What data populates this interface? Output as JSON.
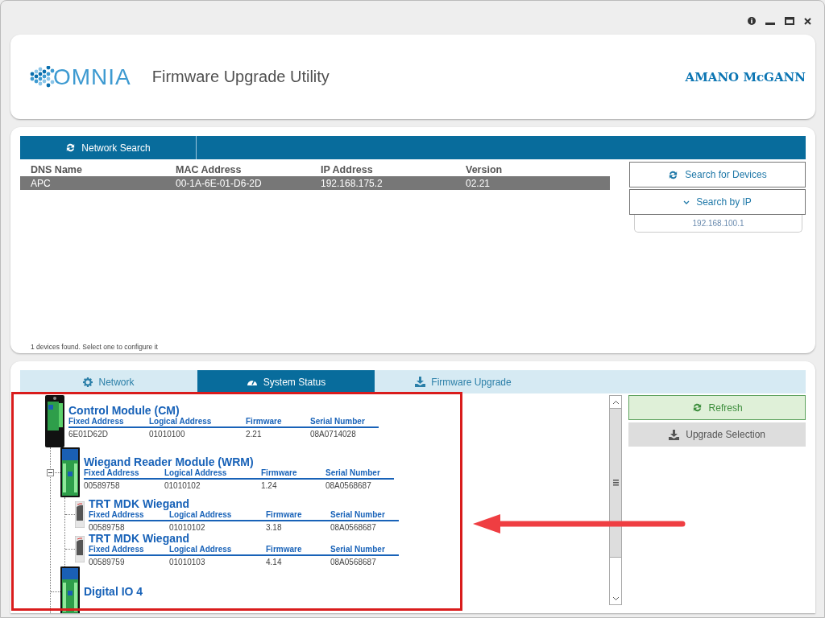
{
  "header": {
    "logo_text": "OMNIA",
    "title": "Firmware Upgrade Utility",
    "brand": "AMANO McGANN"
  },
  "network_search": {
    "tabs": [
      {
        "label": "Network Search",
        "selected": true
      }
    ],
    "table": {
      "columns": [
        "DNS Name",
        "MAC Address",
        "IP Address",
        "Version"
      ],
      "rows": [
        {
          "cells": [
            "APC",
            "00-1A-6E-01-D6-2D",
            "192.168.175.2",
            "02.21"
          ],
          "selected": true
        }
      ]
    },
    "status": "1 devices found. Select one to configure it",
    "buttons": [
      {
        "label": "Search for Devices",
        "kind": "refresh"
      },
      {
        "label": "Search by IP",
        "kind": "expand"
      }
    ],
    "ip_field": {
      "value": "192.168.100.1"
    }
  },
  "system_panel": {
    "tabs": [
      {
        "label": "Network",
        "kind": "gear",
        "selected": false
      },
      {
        "label": "System Status",
        "kind": "gauge",
        "selected": true
      },
      {
        "label": "Firmware Upgrade",
        "kind": "download",
        "selected": false
      }
    ],
    "devices": [
      {
        "name": "Control Module (CM)",
        "kind": "controller",
        "fields": [
          {
            "label": "Fixed Address",
            "value": "6E01D62D"
          },
          {
            "label": "Logical Address",
            "value": "01010100"
          },
          {
            "label": "Firmware",
            "value": "2.21"
          },
          {
            "label": "Serial Number",
            "value": "08A0714028"
          }
        ],
        "children": [
          {
            "name": "Wiegand Reader Module (WRM)",
            "kind": "board",
            "expanded": true,
            "fields": [
              {
                "label": "Fixed Address",
                "value": "00589758"
              },
              {
                "label": "Logical Address",
                "value": "01010102"
              },
              {
                "label": "Firmware",
                "value": "1.24"
              },
              {
                "label": "Serial Number",
                "value": "08A0568687"
              }
            ],
            "children": [
              {
                "name": "TRT MDK Wiegand",
                "kind": "reader",
                "fields": [
                  {
                    "label": "Fixed Address",
                    "value": "00589758"
                  },
                  {
                    "label": "Logical Address",
                    "value": "01010102"
                  },
                  {
                    "label": "Firmware",
                    "value": "3.18"
                  },
                  {
                    "label": "Serial Number",
                    "value": "08A0568687"
                  }
                ]
              },
              {
                "name": "TRT MDK Wiegand",
                "kind": "reader",
                "fields": [
                  {
                    "label": "Fixed Address",
                    "value": "00589759"
                  },
                  {
                    "label": "Logical Address",
                    "value": "01010103"
                  },
                  {
                    "label": "Firmware",
                    "value": "4.14"
                  },
                  {
                    "label": "Serial Number",
                    "value": "08A0568687"
                  }
                ]
              }
            ]
          },
          {
            "name": "Digital IO 4",
            "kind": "board"
          }
        ]
      }
    ],
    "buttons": [
      {
        "label": "Refresh",
        "kind": "refresh"
      },
      {
        "label": "Upgrade Selection",
        "kind": "download"
      }
    ]
  }
}
